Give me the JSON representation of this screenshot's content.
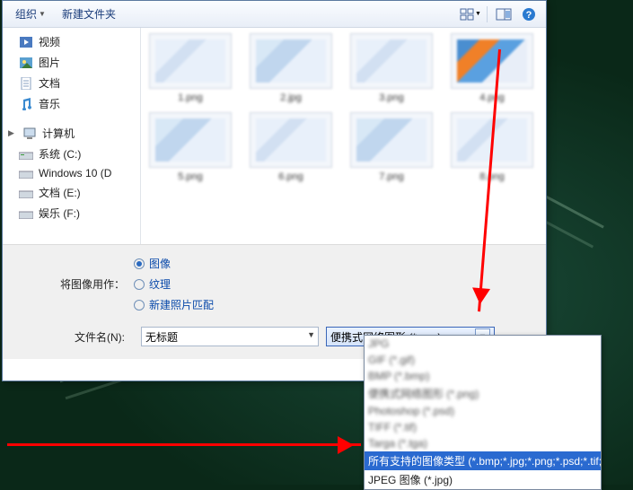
{
  "toolbar": {
    "organize": "组织",
    "new_folder": "新建文件夹"
  },
  "nav": {
    "video": "视频",
    "pictures": "图片",
    "documents": "文档",
    "music": "音乐",
    "computer": "计算机",
    "drive_c": "系统 (C:)",
    "drive_d": "Windows 10 (D",
    "drive_e": "文档 (E:)",
    "drive_f": "娱乐 (F:)"
  },
  "thumbs": [
    "1.png",
    "2.jpg",
    "3.png",
    "4.png",
    "5.png",
    "6.png",
    "7.png",
    "8.png"
  ],
  "use_as": {
    "label": "将图像用作：",
    "opt_image": "图像",
    "opt_texture": "纹理",
    "opt_match": "新建照片匹配"
  },
  "filename": {
    "label": "文件名(N):",
    "value": "无标题"
  },
  "filetype": {
    "selected": "便携式网络图形 (*.png)"
  },
  "dropdown": {
    "items_blur": [
      "JPG",
      "GIF (*.gif)",
      "BMP (*.bmp)",
      "便携式网络图形 (*.png)",
      "Photoshop (*.psd)",
      "TIFF (*.tif)",
      "Targa (*.tga)"
    ],
    "highlight": "所有支持的图像类型 (*.bmp;*.jpg;*.png;*.psd;*.tif;*.tga)",
    "last": "JPEG 图像 (*.jpg)"
  }
}
